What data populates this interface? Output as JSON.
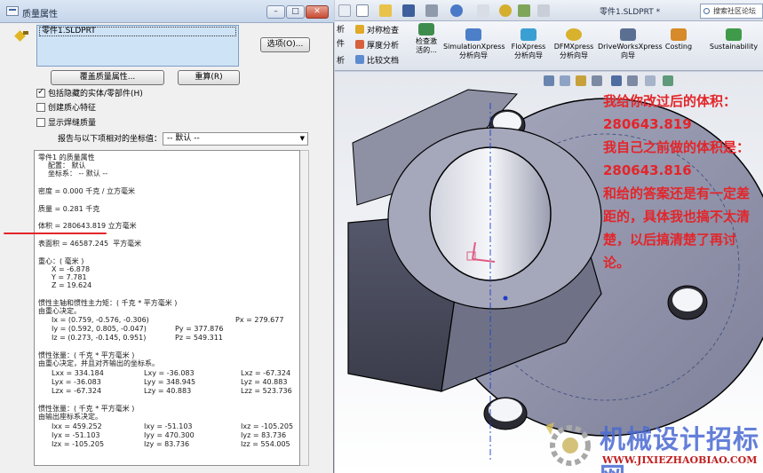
{
  "dialog": {
    "title": "质量属性",
    "selection_item": "零件1.SLDPRT",
    "options_button": "选项(O)...",
    "override_button": "覆盖质量属性...",
    "recalc_button": "重算(R)",
    "include_hidden": "包括隐藏的实体/零部件(H)",
    "include_hidden_checked": true,
    "create_com": "创建质心特征",
    "create_com_checked": false,
    "show_weld": "显示焊缝质量",
    "show_weld_checked": false,
    "coord_label": "报告与以下项相对的坐标值：",
    "coord_value": "-- 默认 --"
  },
  "report": {
    "heading": "零件1 的质量属性",
    "config": "配置： 默认",
    "coord": "坐标系： -- 默认 --",
    "density": "密度 = 0.000 千克 / 立方毫米",
    "mass": "质量 = 0.281 千克",
    "volume": "体积 = 280643.819 立方毫米",
    "surface": "表面积 = 46587.245  平方毫米",
    "com_title": "重心：( 毫米 )",
    "com_x": "X = -6.878",
    "com_y": "Y = 7.781",
    "com_z": "Z = 19.624",
    "principal_title": "惯性主轴和惯性主力矩：( 千克 * 平方毫米 )",
    "principal_sub": "由重心决定。",
    "ix": "Ix = (0.759, -0.576, -0.306)",
    "px": "Px = 279.677",
    "iy": "Iy = (0.592, 0.805, -0.047)",
    "py": "Py = 377.876",
    "iz": "Iz = (0.273, -0.145, 0.951)",
    "pz": "Pz = 549.311",
    "tensor1_title": "惯性张量：( 千克 * 平方毫米 )",
    "tensor1_sub": "由重心决定，并且对齐输出的坐标系。",
    "t1": [
      [
        "Lxx = 334.184",
        "Lxy = -36.083",
        "Lxz = -67.324"
      ],
      [
        "Lyx = -36.083",
        "Lyy = 348.945",
        "Lyz = 40.883"
      ],
      [
        "Lzx = -67.324",
        "Lzy = 40.883",
        "Lzz = 523.736"
      ]
    ],
    "tensor2_title": "惯性张量：( 千克 * 平方毫米 )",
    "tensor2_sub": "由输出座标系决定。",
    "t2": [
      [
        "Ixx = 459.252",
        "Ixy = -51.103",
        "Ixz = -105.205"
      ],
      [
        "Iyx = -51.103",
        "Iyy = 470.300",
        "Iyz = 83.736"
      ],
      [
        "Izx = -105.205",
        "Izy = 83.736",
        "Izz = 554.005"
      ]
    ]
  },
  "sw": {
    "doc_title": "零件1.SLDPRT *",
    "search_placeholder": "搜索社区论坛",
    "ribbon_small": [
      "对称检查",
      "厚度分析",
      "比较文档"
    ],
    "ribbon_partial": [
      "析",
      "件",
      "析"
    ],
    "ribbon_check": "检查激活的...",
    "ribbon_big": [
      "SimulationXpress 分析向导",
      "FloXpress 分析向导",
      "DFMXpress 分析向导",
      "DriveWorksXpress 向导",
      "Costing",
      "Sustainability"
    ]
  },
  "annotation": {
    "lines": [
      "我给你改过后的体积：",
      "280643.819",
      "我自己之前做的体积是：",
      "280643.816",
      "和给的答案还是有一定差",
      "距的，具体我也搞不太清",
      "楚，以后搞清楚了再讨",
      "论。"
    ],
    "color": "#e3252a"
  },
  "watermark": {
    "text": "机械设计招标网",
    "url": "WWW.JIXIEZHAOBIAO.COM"
  }
}
